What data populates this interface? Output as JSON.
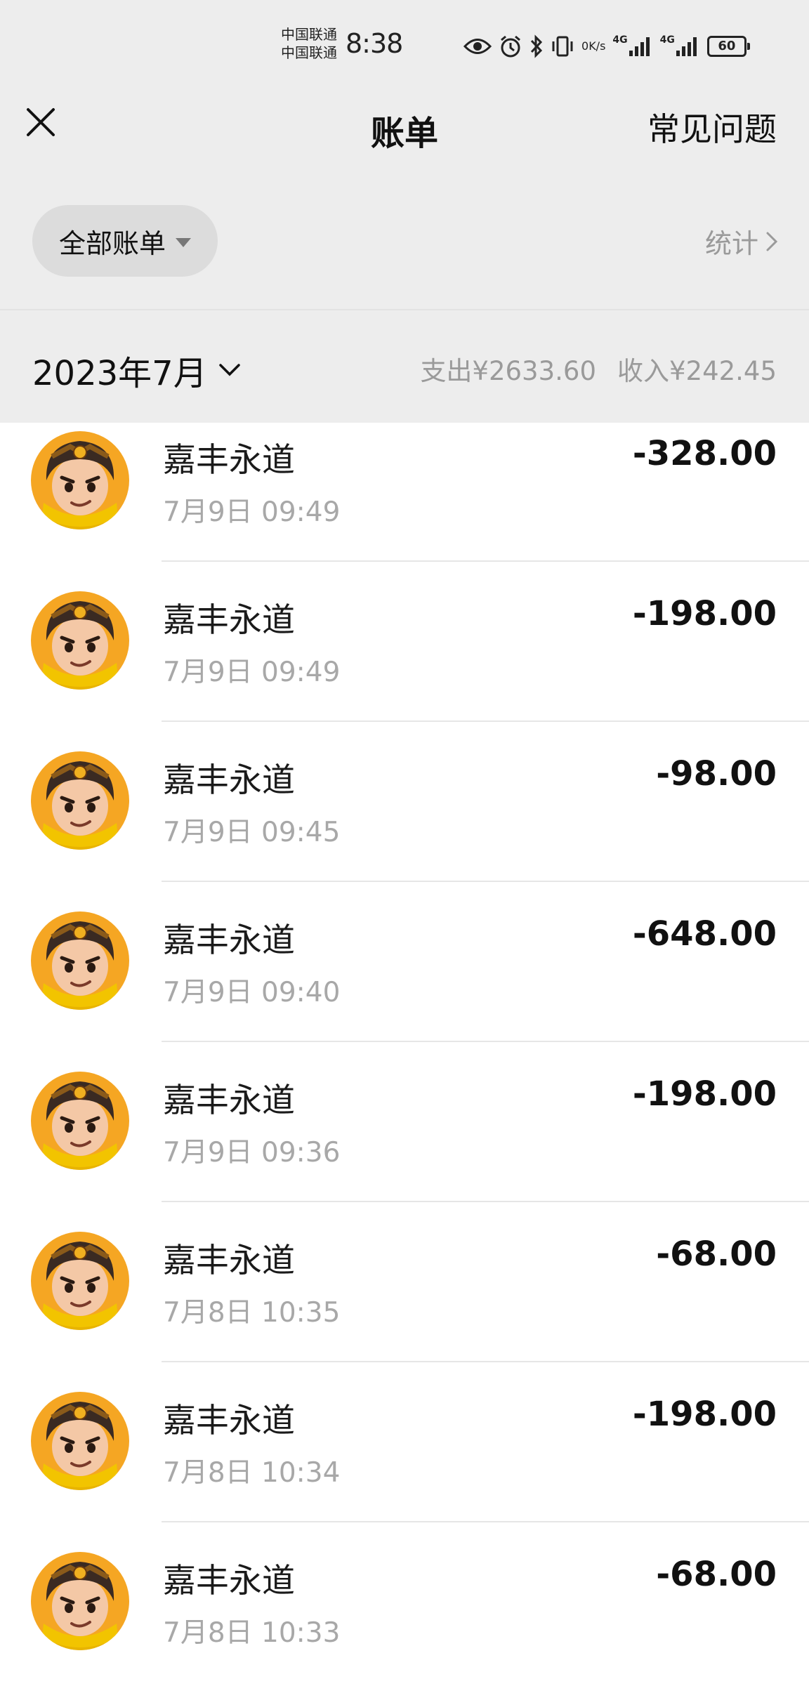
{
  "status_bar": {
    "carrier_1": "中国联通",
    "carrier_2": "中国联通",
    "time": "8:38",
    "net_speed_value": "0",
    "net_speed_unit": "K/s",
    "signal_1": "4G",
    "signal_2": "4G",
    "battery": "60",
    "icons": [
      "eye-icon",
      "alarm-icon",
      "bluetooth-icon",
      "vibrate-icon",
      "signal-icon",
      "battery-icon"
    ]
  },
  "header": {
    "title": "账单",
    "faq_label": "常见问题",
    "close_icon": "close-icon"
  },
  "filter": {
    "selected": "全部账单",
    "stats_label": "统计"
  },
  "summary": {
    "month": "2023年7月",
    "expense": "支出¥2633.60",
    "income": "收入¥242.45"
  },
  "transactions": [
    {
      "name": "嘉丰永道",
      "time": "7月9日 09:49",
      "amount": "-328.00"
    },
    {
      "name": "嘉丰永道",
      "time": "7月9日 09:49",
      "amount": "-198.00"
    },
    {
      "name": "嘉丰永道",
      "time": "7月9日 09:45",
      "amount": "-98.00"
    },
    {
      "name": "嘉丰永道",
      "time": "7月9日 09:40",
      "amount": "-648.00"
    },
    {
      "name": "嘉丰永道",
      "time": "7月9日 09:36",
      "amount": "-198.00"
    },
    {
      "name": "嘉丰永道",
      "time": "7月8日 10:35",
      "amount": "-68.00"
    },
    {
      "name": "嘉丰永道",
      "time": "7月8日 10:34",
      "amount": "-198.00"
    },
    {
      "name": "嘉丰永道",
      "time": "7月8日 10:33",
      "amount": "-68.00"
    }
  ],
  "colors": {
    "header_bg": "#ededed",
    "avatar_bg": "#f5a623",
    "secondary_text": "#a8a8a8"
  }
}
